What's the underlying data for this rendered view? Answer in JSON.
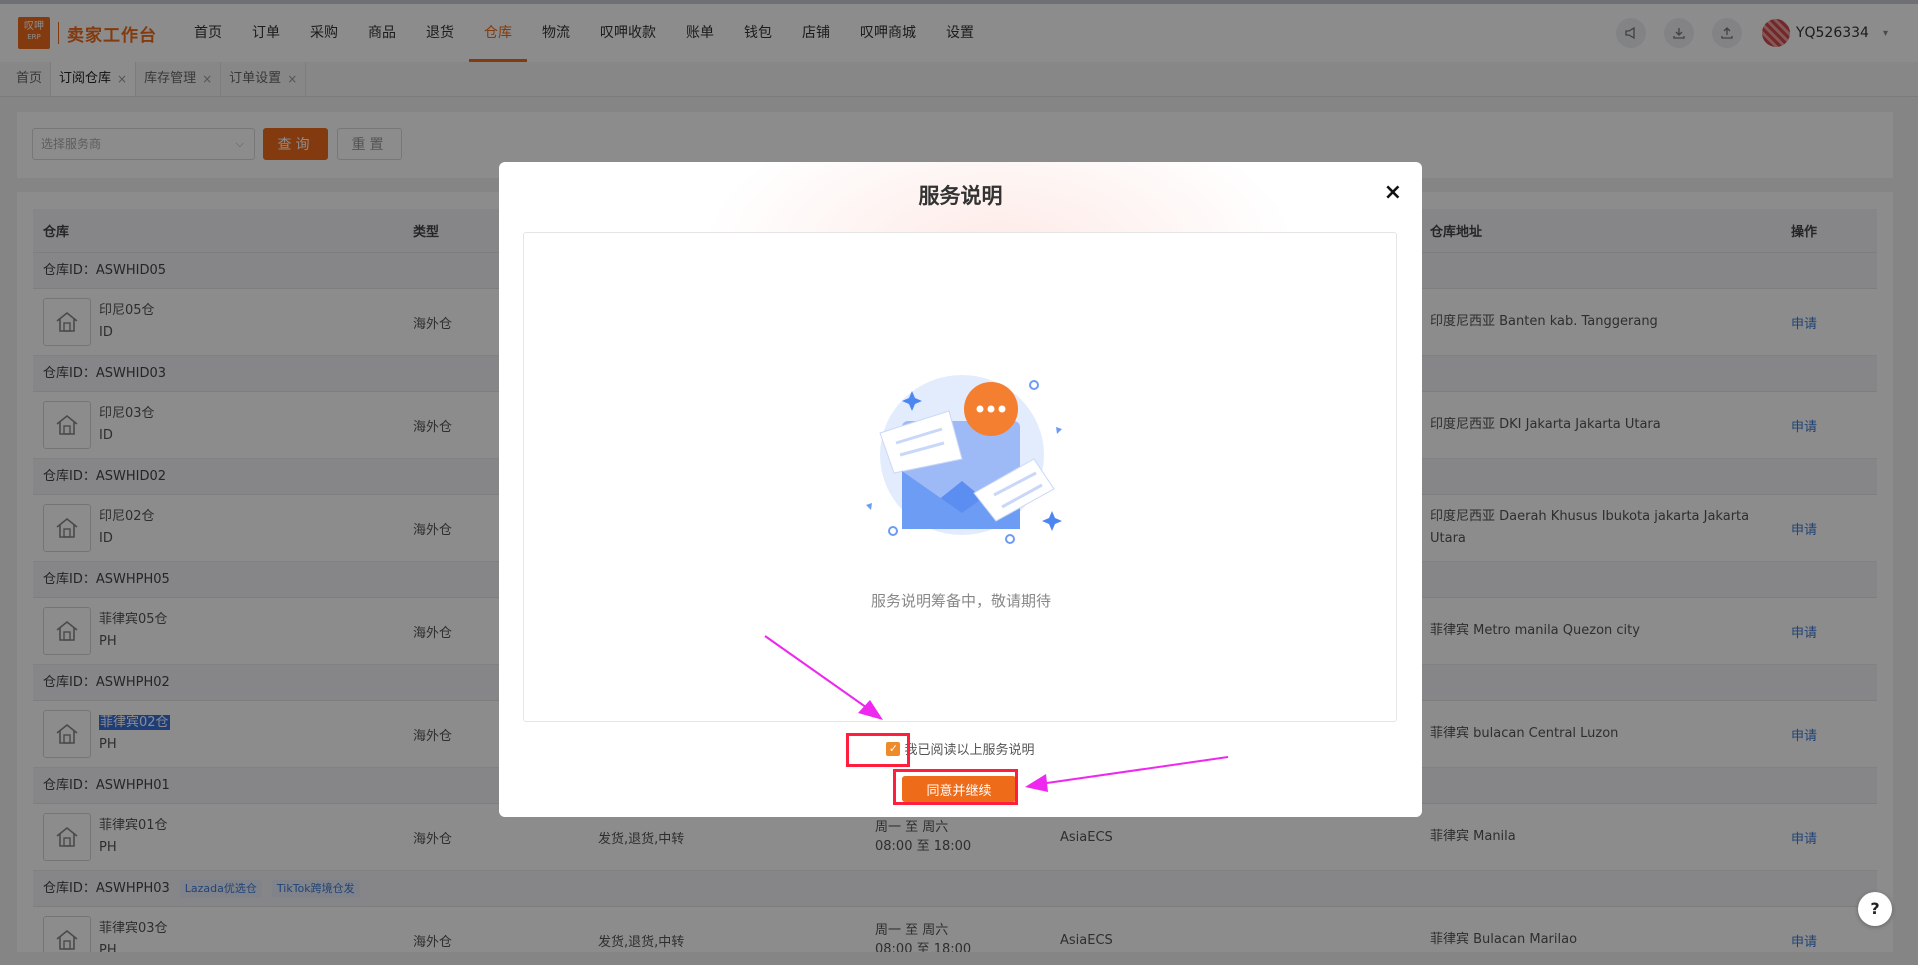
{
  "brand": {
    "logo_top": "叹呷",
    "logo_bottom": "ERP",
    "name": "卖家工作台"
  },
  "nav": [
    {
      "label": "首页"
    },
    {
      "label": "订单"
    },
    {
      "label": "采购"
    },
    {
      "label": "商品"
    },
    {
      "label": "退货"
    },
    {
      "label": "仓库",
      "active": true
    },
    {
      "label": "物流"
    },
    {
      "label": "叹呷收款"
    },
    {
      "label": "账单"
    },
    {
      "label": "钱包"
    },
    {
      "label": "店铺"
    },
    {
      "label": "叹呷商城"
    },
    {
      "label": "设置"
    }
  ],
  "user": {
    "name": "YQ526334",
    "icons": [
      "megaphone-icon",
      "download-icon",
      "upload-icon"
    ]
  },
  "tabs": [
    {
      "label": "首页",
      "closable": false
    },
    {
      "label": "订阅仓库",
      "closable": true,
      "active": true
    },
    {
      "label": "库存管理",
      "closable": true
    },
    {
      "label": "订单设置",
      "closable": true
    }
  ],
  "filter": {
    "select_placeholder": "选择服务商",
    "query_label": "查询",
    "reset_label": "重置"
  },
  "table": {
    "headers": [
      "仓库",
      "类型",
      "",
      "",
      "",
      "仓库地址",
      "操作"
    ],
    "groups": [
      {
        "id_label": "仓库ID：ASWHID05",
        "tags": [],
        "name": "印尼05仓",
        "code": "ID",
        "type": "海外仓",
        "services": "",
        "hours1": "",
        "hours2": "",
        "provider": "",
        "address": "印度尼西亚 Banten kab. Tanggerang",
        "action": "申请"
      },
      {
        "id_label": "仓库ID：ASWHID03",
        "tags": [],
        "name": "印尼03仓",
        "code": "ID",
        "type": "海外仓",
        "services": "",
        "hours1": "",
        "hours2": "",
        "provider": "",
        "address": "印度尼西亚 DKI Jakarta Jakarta Utara",
        "action": "申请"
      },
      {
        "id_label": "仓库ID：ASWHID02",
        "tags": [],
        "name": "印尼02仓",
        "code": "ID",
        "type": "海外仓",
        "services": "",
        "hours1": "",
        "hours2": "",
        "provider": "",
        "address": "印度尼西亚 Daerah Khusus Ibukota jakarta Jakarta Utara",
        "action": "申请"
      },
      {
        "id_label": "仓库ID：ASWHPH05",
        "tags": [],
        "name": "菲律宾05仓",
        "code": "PH",
        "type": "海外仓",
        "services": "",
        "hours1": "",
        "hours2": "",
        "provider": "",
        "address": "菲律宾 Metro manila Quezon city",
        "action": "申请"
      },
      {
        "id_label": "仓库ID：ASWHPH02",
        "tags": [],
        "name": "菲律宾02仓",
        "code": "PH",
        "type": "海外仓",
        "services": "",
        "hours1": "",
        "hours2": "",
        "provider": "",
        "address": "菲律宾 bulacan Central Luzon",
        "action": "申请",
        "highlight": true
      },
      {
        "id_label": "仓库ID：ASWHPH01",
        "tags": [],
        "name": "菲律宾01仓",
        "code": "PH",
        "type": "海外仓",
        "services": "发货,退货,中转",
        "hours1": "周一 至 周六",
        "hours2": "08:00 至 18:00",
        "provider": "AsiaECS",
        "address": "菲律宾 Manila",
        "action": "申请"
      },
      {
        "id_label": "仓库ID：ASWHPH03",
        "tags": [
          "Lazada优选仓",
          "TikTok跨境仓发"
        ],
        "name": "菲律宾03仓",
        "code": "PH",
        "type": "海外仓",
        "services": "发货,退货,中转",
        "hours1": "周一 至 周六",
        "hours2": "08:00 至 18:00",
        "provider": "AsiaECS",
        "address": "菲律宾 Bulacan Marilao",
        "action": "申请"
      }
    ]
  },
  "modal": {
    "title": "服务说明",
    "close": "×",
    "pending_text": "服务说明筹备中，敬请期待",
    "checkbox_label": "我已阅读以上服务说明",
    "checked": true,
    "agree_label": "同意并继续"
  },
  "help_label": "?",
  "colors": {
    "accent": "#ee6b1a",
    "link": "#3d7ad8",
    "annotation_box": "#ff1f3d",
    "annotation_arrow": "#ee28ee"
  }
}
